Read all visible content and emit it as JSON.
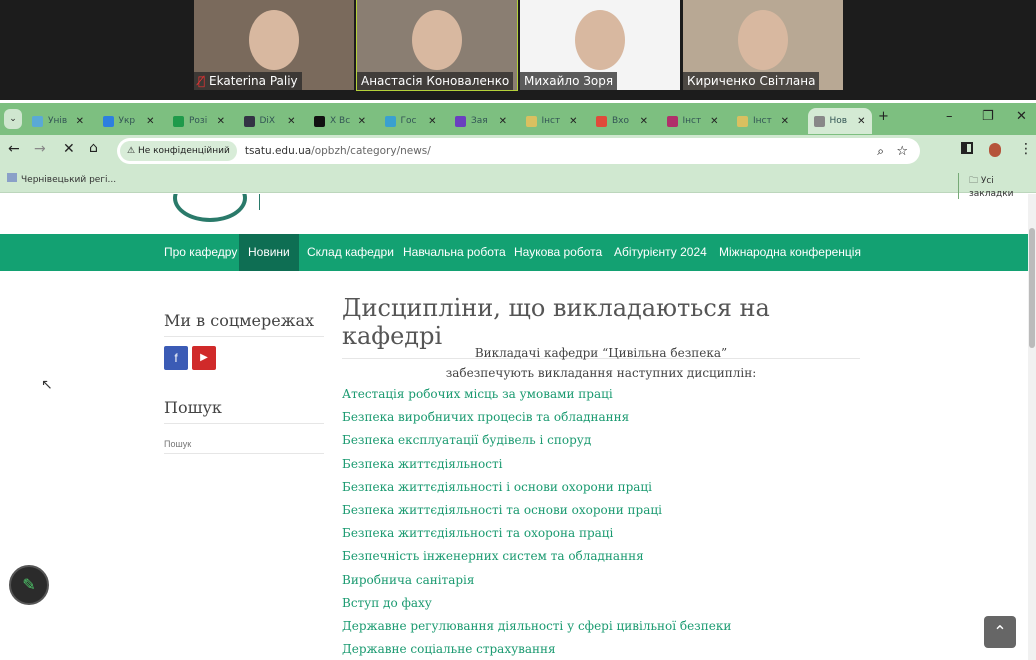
{
  "call": {
    "participants": [
      {
        "name": "Ekaterina Paliy",
        "muted": true,
        "bg": "#7a6a5c"
      },
      {
        "name": "Анастасія Коноваленко",
        "muted": false,
        "bg": "#8a7e72"
      },
      {
        "name": "Михайло Зоря",
        "muted": false,
        "bg": "#f4f4f4"
      },
      {
        "name": "Кириченко Світлана",
        "muted": false,
        "bg": "#b8a894"
      }
    ]
  },
  "browser": {
    "tabs": [
      {
        "label": "Унів",
        "color": "#5aa9d6"
      },
      {
        "label": "Укр",
        "color": "#2d7fe0"
      },
      {
        "label": "Розі",
        "color": "#1f9a4a"
      },
      {
        "label": "DiX",
        "color": "#334"
      },
      {
        "label": "X Вс",
        "color": "#111"
      },
      {
        "label": "Гос",
        "color": "#3aa0d0"
      },
      {
        "label": "Зая",
        "color": "#6a3fbf"
      },
      {
        "label": "Інст",
        "color": "#d9c060"
      },
      {
        "label": "Вхо",
        "color": "#e04a3a"
      },
      {
        "label": "Інст",
        "color": "#b0306a"
      },
      {
        "label": "Інст",
        "color": "#d9c060"
      },
      {
        "label": "Нов",
        "color": "#888",
        "active": true
      }
    ],
    "security_label": "Не конфіденційний",
    "url_host": "tsatu.edu.ua",
    "url_path": "/opbzh/category/news/",
    "bookmark": "Чернівецький регі...",
    "all_bookmarks": "Усі закладки"
  },
  "nav": [
    "Про кафедру",
    "Новини",
    "Склад кафедри",
    "Навчальна робота",
    "Наукова робота",
    "Абітурієнту 2024",
    "Міжнародна конференція"
  ],
  "sidebar": {
    "social_title": "Ми в соцмережах",
    "search_title": "Пошук",
    "search_placeholder": "Пошук"
  },
  "main": {
    "title": "Дисципліни, що викладаються на кафедрі",
    "intro1": "Викладачі кафедри “Цивільна безпека”",
    "intro2": "забезпечують викладання наступних дисциплін:",
    "disciplines": [
      "Атестація робочих місць за умовами праці",
      "Безпека виробничих процесів та обладнання",
      "Безпека експлуатації будівель і споруд",
      "Безпека життєдіяльності",
      "Безпека життєдіяльності і основи охорони праці",
      "Безпека життєдіяльності та основи охорони праці",
      "Безпека життєдіяльності та охорона праці",
      "Безпечність інженерних систем та обладнання",
      "Виробнича санітарія",
      "Вступ до фаху",
      "Державне регулювання діяльності у сфері цивільної безпеки",
      "Державне соціальне страхування"
    ]
  }
}
